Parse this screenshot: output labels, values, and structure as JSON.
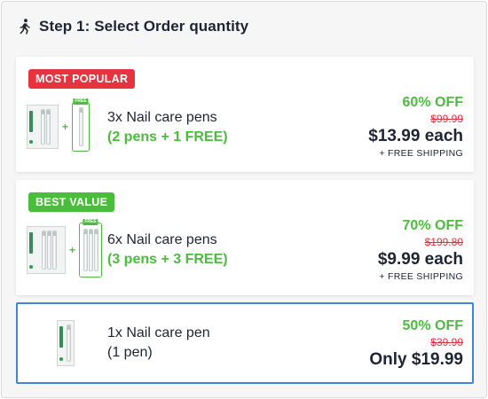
{
  "header": {
    "icon": "walking-person-icon",
    "title": "Step 1: Select Order quantity"
  },
  "colors": {
    "accent_green": "#4bbd3c",
    "badge_red": "#e6333f",
    "strike_red": "#e0323c",
    "selected_border": "#3d86d9",
    "text_dark": "#1f2433"
  },
  "offers": [
    {
      "badge": "MOST POPULAR",
      "title": "3x Nail care pens",
      "subtitle": "(2 pens + 1 FREE)",
      "discount": "60% OFF",
      "old_price": "$99.99",
      "price": "$13.99 each",
      "shipping": "+ FREE SHIPPING",
      "free_tag": "FREE",
      "plus": "+",
      "selected": false
    },
    {
      "badge": "BEST VALUE",
      "title": "6x Nail care pens",
      "subtitle": "(3 pens + 3 FREE)",
      "discount": "70% OFF",
      "old_price": "$199.80",
      "price": "$9.99 each",
      "shipping": "+ FREE SHIPPING",
      "free_tag": "FREE",
      "plus": "+",
      "selected": false
    },
    {
      "title": "1x Nail care pen",
      "subtitle": "(1 pen)",
      "discount": "50% OFF",
      "old_price": "$39.99",
      "price": "Only $19.99",
      "selected": true
    }
  ]
}
